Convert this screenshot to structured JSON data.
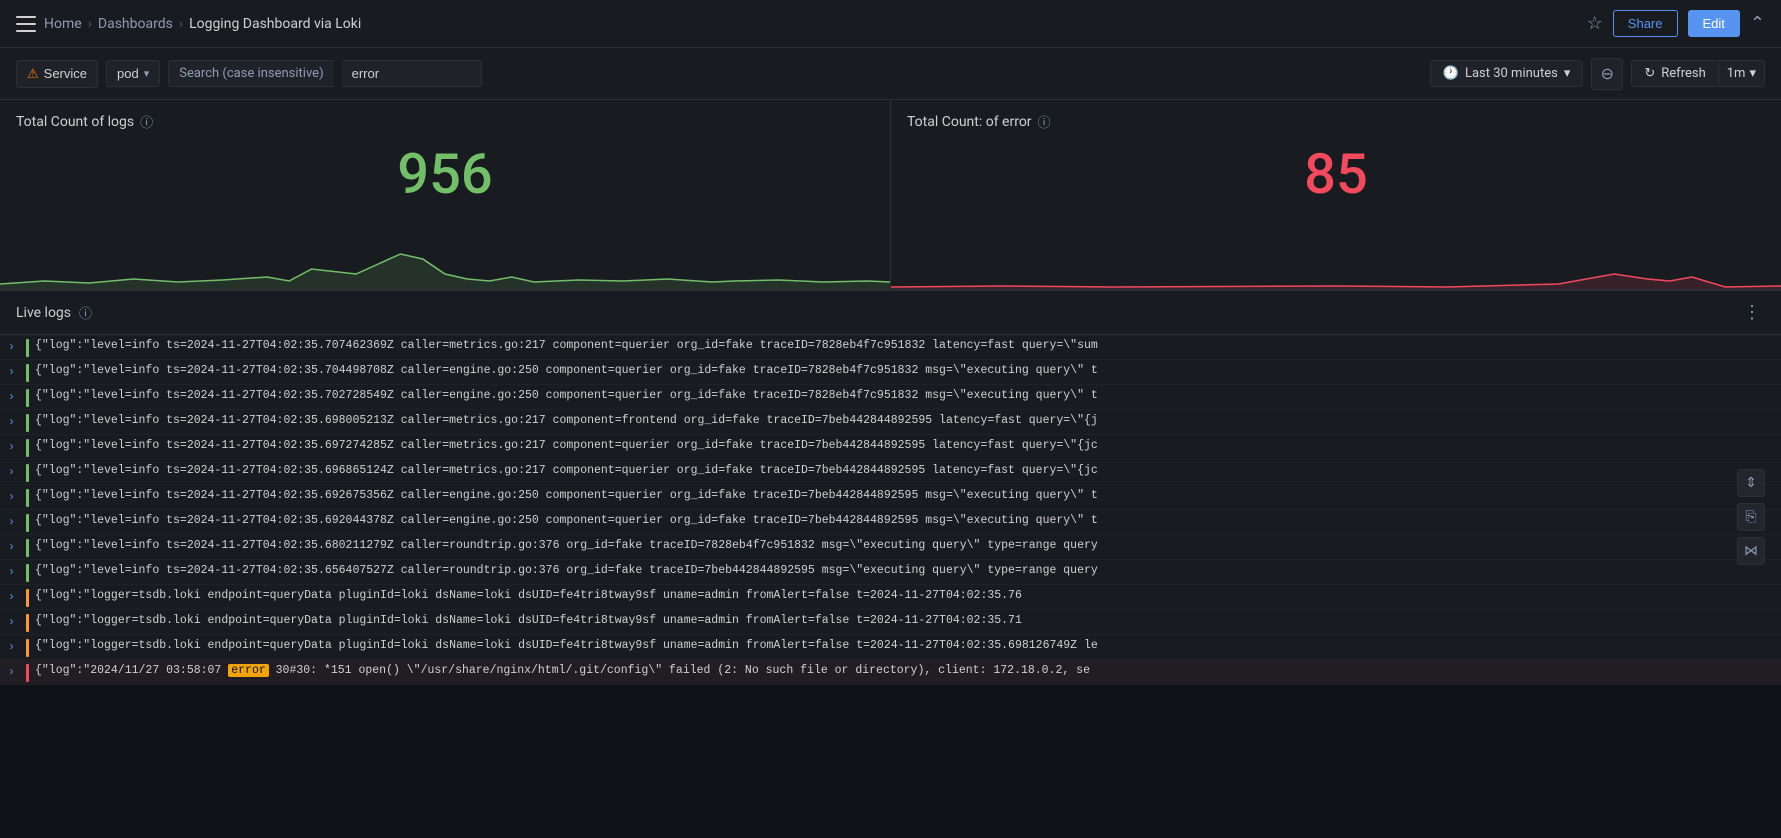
{
  "nav": {
    "home": "Home",
    "dashboards": "Dashboards",
    "current": "Logging Dashboard via Loki",
    "share_label": "Share",
    "edit_label": "Edit"
  },
  "toolbar": {
    "service_label": "Service",
    "pod_label": "pod",
    "search_placeholder": "Search (case insensitive)",
    "search_value": "error",
    "time_label": "Last 30 minutes",
    "refresh_label": "Refresh",
    "interval_label": "1m"
  },
  "panel_left": {
    "title": "Total Count of logs",
    "value": "956"
  },
  "panel_right": {
    "title": "Total Count: of error",
    "value": "85"
  },
  "live_logs": {
    "title": "Live logs",
    "entries": [
      {
        "level": "green",
        "text": "{\"log\":\"level=info ts=2024-11-27T04:02:35.707462369Z caller=metrics.go:217 component=querier org_id=fake traceID=7828eb4f7c951832 latency=fast query=\\\"sum"
      },
      {
        "level": "green",
        "text": "{\"log\":\"level=info ts=2024-11-27T04:02:35.704498708Z caller=engine.go:250 component=querier org_id=fake traceID=7828eb4f7c951832 msg=\\\"executing query\\\" t"
      },
      {
        "level": "green",
        "text": "{\"log\":\"level=info ts=2024-11-27T04:02:35.702728549Z caller=engine.go:250 component=querier org_id=fake traceID=7828eb4f7c951832 msg=\\\"executing query\\\" t"
      },
      {
        "level": "green",
        "text": "{\"log\":\"level=info ts=2024-11-27T04:02:35.698005213Z caller=metrics.go:217 component=frontend org_id=fake traceID=7beb442844892595 latency=fast query=\\\"{j"
      },
      {
        "level": "green",
        "text": "{\"log\":\"level=info ts=2024-11-27T04:02:35.697274285Z caller=metrics.go:217 component=querier org_id=fake traceID=7beb442844892595 latency=fast query=\\\"{jc"
      },
      {
        "level": "green",
        "text": "{\"log\":\"level=info ts=2024-11-27T04:02:35.696865124Z caller=metrics.go:217 component=querier org_id=fake traceID=7beb442844892595 latency=fast query=\\\"{jc"
      },
      {
        "level": "green",
        "text": "{\"log\":\"level=info ts=2024-11-27T04:02:35.692675356Z caller=engine.go:250 component=querier org_id=fake traceID=7beb442844892595 msg=\\\"executing query\\\" t"
      },
      {
        "level": "green",
        "text": "{\"log\":\"level=info ts=2024-11-27T04:02:35.692044378Z caller=engine.go:250 component=querier org_id=fake traceID=7beb442844892595 msg=\\\"executing query\\\" t"
      },
      {
        "level": "green",
        "text": "{\"log\":\"level=info ts=2024-11-27T04:02:35.680211279Z caller=roundtrip.go:376 org_id=fake traceID=7828eb4f7c951832 msg=\\\"executing query\\\" type=range query"
      },
      {
        "level": "green",
        "text": "{\"log\":\"level=info ts=2024-11-27T04:02:35.656407527Z caller=roundtrip.go:376 org_id=fake traceID=7beb442844892595 msg=\\\"executing query\\\" type=range query"
      },
      {
        "level": "orange",
        "text": "{\"log\":\"logger=tsdb.loki endpoint=queryData pluginId=loki dsName=loki dsUID=fe4tri8tway9sf uname=admin fromAlert=false t=2024-11-27T04:02:35.76"
      },
      {
        "level": "orange",
        "text": "{\"log\":\"logger=tsdb.loki endpoint=queryData pluginId=loki dsName=loki dsUID=fe4tri8tway9sf uname=admin fromAlert=false t=2024-11-27T04:02:35.71"
      },
      {
        "level": "orange",
        "text": "{\"log\":\"logger=tsdb.loki endpoint=queryData pluginId=loki dsName=loki dsUID=fe4tri8tway9sf uname=admin fromAlert=false t=2024-11-27T04:02:35.698126749Z le"
      },
      {
        "level": "red",
        "text": "{\"log\":\"2024/11/27 03:58:07 [error] 30#30: *151 open() \\\"/usr/share/nginx/html/.git/config\\\" failed (2: No such file or directory), client: 172.18.0.2, se",
        "hasError": true
      }
    ]
  }
}
